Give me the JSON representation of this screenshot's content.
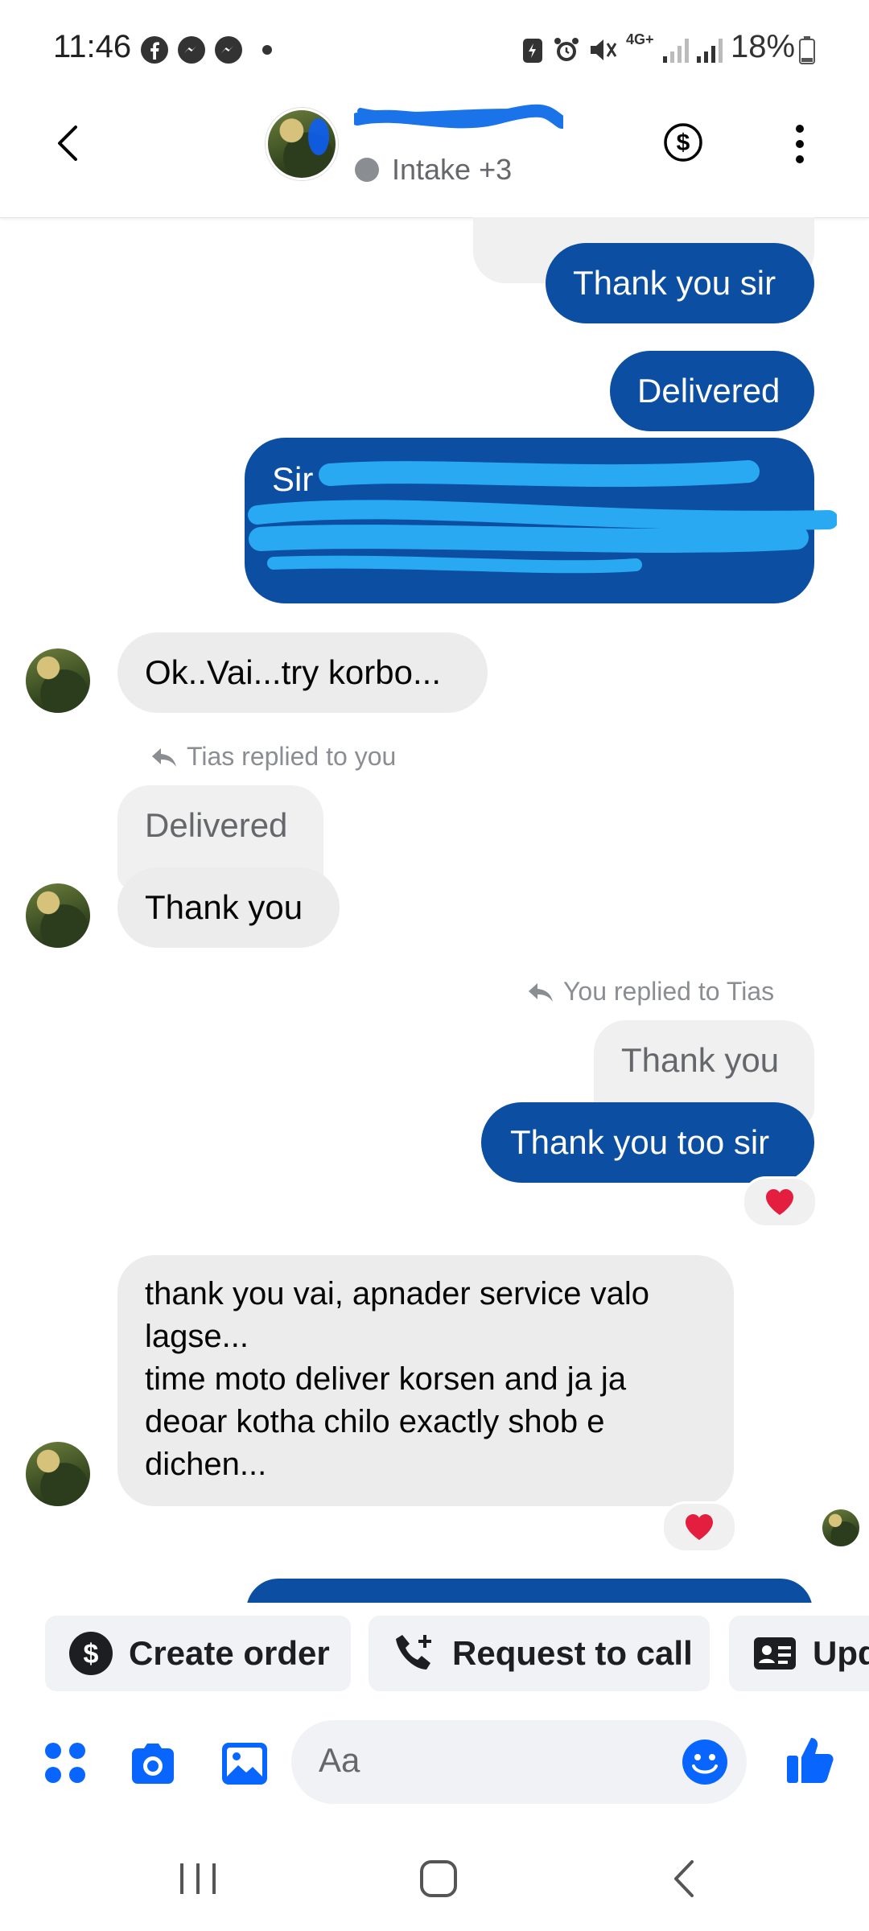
{
  "status": {
    "time": "11:46",
    "network": "4G+",
    "battery": "18%"
  },
  "header": {
    "subtitle": "Intake +3",
    "dollar_icon": "dollar-icon",
    "more_icon": "more-vertical-icon"
  },
  "messages": {
    "m1": "Thank you sir",
    "m2": "Delivered",
    "m3_visible": "Sir",
    "m4": "Ok..Vai...try korbo...",
    "reply_note_1": "Tias replied to you",
    "quoted_1": "Delivered",
    "m5": "Thank you",
    "reply_note_2": "You replied to Tias",
    "quoted_2": "Thank you",
    "m6": "Thank you too sir",
    "m7": "thank you vai, apnader service valo\nlagse...\ntime moto deliver korsen and ja ja\ndeoar kotha chilo exactly shob e\ndichen..."
  },
  "quick_actions": {
    "create_order": "Create order",
    "request_call": "Request to call",
    "update": "Upd"
  },
  "composer": {
    "placeholder": "Aa"
  },
  "colors": {
    "outgoing_bubble": "#0b4ea2",
    "incoming_bubble": "#ececec",
    "messenger_blue": "#0866ff",
    "heart": "#e41e3f"
  }
}
